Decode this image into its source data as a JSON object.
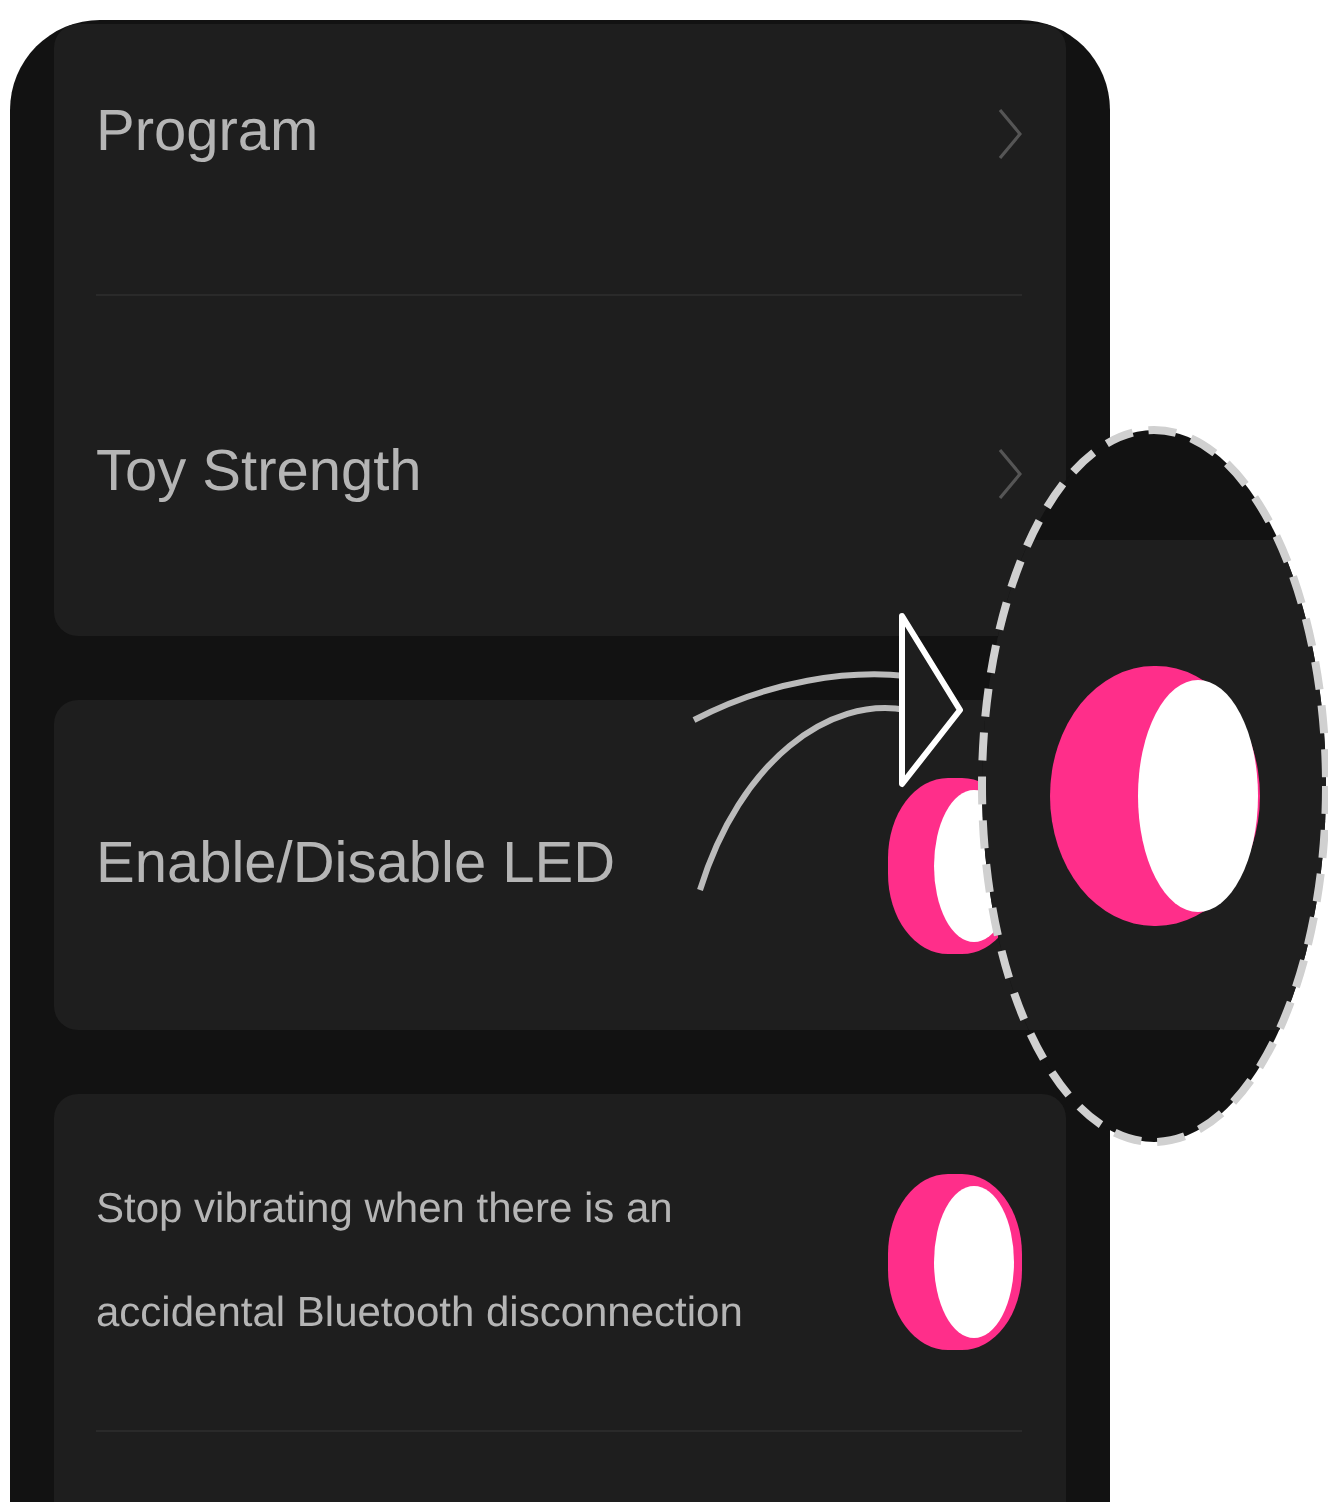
{
  "cards": [
    {
      "rows": [
        {
          "kind": "link",
          "label": "Program"
        },
        {
          "kind": "link",
          "label": "Toy Strength"
        }
      ]
    },
    {
      "rows": [
        {
          "kind": "toggle",
          "label": "Enable/Disable LED",
          "on": true
        }
      ]
    },
    {
      "rows": [
        {
          "kind": "toggle",
          "label": "Stop vibrating when there is an accidental Bluetooth disconnection",
          "on": true
        }
      ]
    }
  ],
  "magnifier": {
    "on": true
  }
}
